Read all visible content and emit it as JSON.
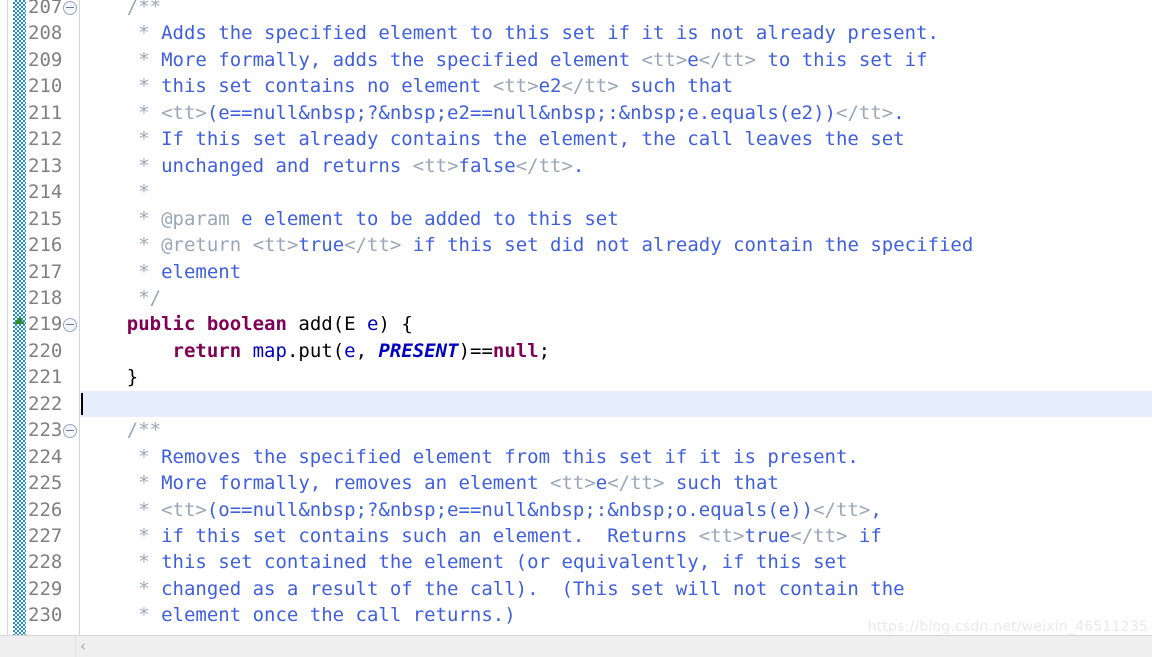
{
  "app": {
    "kind": "java-source-editor",
    "language": "Java",
    "theme_background": "#ffffff"
  },
  "colors": {
    "javadoc_text": "#3f5fdf",
    "javadoc_tag": "#9ba6b8",
    "keyword": "#7f0055",
    "field": "#0000c0",
    "static_field": "#0000c0",
    "plain": "#000000",
    "current_line_highlight": "#e6eefc",
    "change_bar": "#1e8fd5",
    "line_number": "#808080",
    "marker_green": "#2e8b2e"
  },
  "gutter": {
    "first_visible_line": 207,
    "last_visible_line": 230,
    "fold_marker_lines": [
      207,
      219,
      223
    ],
    "override_marker_lines": [
      219
    ],
    "fold_icon_name": "collapse-circle-icon",
    "override_icon_name": "overrides-method-triangle-icon"
  },
  "editor": {
    "cursor_line": 222,
    "current_line": 222,
    "lines": [
      {
        "n": "207",
        "fold": true,
        "marker": false,
        "tokens": [
          {
            "c": "t-doctag",
            "t": "    /**"
          }
        ]
      },
      {
        "n": "208",
        "fold": false,
        "marker": false,
        "tokens": [
          {
            "c": "t-doctag",
            "t": "     * "
          },
          {
            "c": "t-doc",
            "t": "Adds the specified element to this set if it is not already present."
          }
        ]
      },
      {
        "n": "209",
        "fold": false,
        "marker": false,
        "tokens": [
          {
            "c": "t-doctag",
            "t": "     * "
          },
          {
            "c": "t-doc",
            "t": "More formally, adds the specified element "
          },
          {
            "c": "t-doctag",
            "t": "<tt>"
          },
          {
            "c": "t-doc",
            "t": "e"
          },
          {
            "c": "t-doctag",
            "t": "</tt>"
          },
          {
            "c": "t-doc",
            "t": " to this set if"
          }
        ]
      },
      {
        "n": "210",
        "fold": false,
        "marker": false,
        "tokens": [
          {
            "c": "t-doctag",
            "t": "     * "
          },
          {
            "c": "t-doc",
            "t": "this set contains no element "
          },
          {
            "c": "t-doctag",
            "t": "<tt>"
          },
          {
            "c": "t-doc",
            "t": "e2"
          },
          {
            "c": "t-doctag",
            "t": "</tt>"
          },
          {
            "c": "t-doc",
            "t": " such that"
          }
        ]
      },
      {
        "n": "211",
        "fold": false,
        "marker": false,
        "tokens": [
          {
            "c": "t-doctag",
            "t": "     * "
          },
          {
            "c": "t-doctag",
            "t": "<tt>"
          },
          {
            "c": "t-doc",
            "t": "(e==null&nbsp;?&nbsp;e2==null&nbsp;:&nbsp;e.equals(e2))"
          },
          {
            "c": "t-doctag",
            "t": "</tt>"
          },
          {
            "c": "t-doc",
            "t": "."
          }
        ]
      },
      {
        "n": "212",
        "fold": false,
        "marker": false,
        "tokens": [
          {
            "c": "t-doctag",
            "t": "     * "
          },
          {
            "c": "t-doc",
            "t": "If this set already contains the element, the call leaves the set"
          }
        ]
      },
      {
        "n": "213",
        "fold": false,
        "marker": false,
        "tokens": [
          {
            "c": "t-doctag",
            "t": "     * "
          },
          {
            "c": "t-doc",
            "t": "unchanged and returns "
          },
          {
            "c": "t-doctag",
            "t": "<tt>"
          },
          {
            "c": "t-doc",
            "t": "false"
          },
          {
            "c": "t-doctag",
            "t": "</tt>"
          },
          {
            "c": "t-doc",
            "t": "."
          }
        ]
      },
      {
        "n": "214",
        "fold": false,
        "marker": false,
        "tokens": [
          {
            "c": "t-doctag",
            "t": "     *"
          }
        ]
      },
      {
        "n": "215",
        "fold": false,
        "marker": false,
        "tokens": [
          {
            "c": "t-doctag",
            "t": "     * "
          },
          {
            "c": "t-doctag",
            "t": "@param"
          },
          {
            "c": "t-doc",
            "t": " e element to be added to this set"
          }
        ]
      },
      {
        "n": "216",
        "fold": false,
        "marker": false,
        "tokens": [
          {
            "c": "t-doctag",
            "t": "     * "
          },
          {
            "c": "t-doctag",
            "t": "@return"
          },
          {
            "c": "t-doc",
            "t": " "
          },
          {
            "c": "t-doctag",
            "t": "<tt>"
          },
          {
            "c": "t-doc",
            "t": "true"
          },
          {
            "c": "t-doctag",
            "t": "</tt>"
          },
          {
            "c": "t-doc",
            "t": " if this set did not already contain the specified"
          }
        ]
      },
      {
        "n": "217",
        "fold": false,
        "marker": false,
        "tokens": [
          {
            "c": "t-doctag",
            "t": "     * "
          },
          {
            "c": "t-doc",
            "t": "element"
          }
        ]
      },
      {
        "n": "218",
        "fold": false,
        "marker": false,
        "tokens": [
          {
            "c": "t-doctag",
            "t": "     */"
          }
        ]
      },
      {
        "n": "219",
        "fold": true,
        "marker": true,
        "tokens": [
          {
            "c": "t-plain",
            "t": "    "
          },
          {
            "c": "t-kw",
            "t": "public"
          },
          {
            "c": "t-plain",
            "t": " "
          },
          {
            "c": "t-kw",
            "t": "boolean"
          },
          {
            "c": "t-plain",
            "t": " add(E "
          },
          {
            "c": "t-field",
            "t": "e"
          },
          {
            "c": "t-plain",
            "t": ") {"
          }
        ]
      },
      {
        "n": "220",
        "fold": false,
        "marker": false,
        "tokens": [
          {
            "c": "t-plain",
            "t": "        "
          },
          {
            "c": "t-kw",
            "t": "return"
          },
          {
            "c": "t-plain",
            "t": " "
          },
          {
            "c": "t-field",
            "t": "map"
          },
          {
            "c": "t-plain",
            "t": ".put("
          },
          {
            "c": "t-field",
            "t": "e"
          },
          {
            "c": "t-plain",
            "t": ", "
          },
          {
            "c": "t-static",
            "t": "PRESENT"
          },
          {
            "c": "t-plain",
            "t": ")=="
          },
          {
            "c": "t-kw",
            "t": "null"
          },
          {
            "c": "t-plain",
            "t": ";"
          }
        ]
      },
      {
        "n": "221",
        "fold": false,
        "marker": false,
        "tokens": [
          {
            "c": "t-plain",
            "t": "    }"
          }
        ]
      },
      {
        "n": "222",
        "fold": false,
        "marker": false,
        "tokens": [
          {
            "c": "t-plain",
            "t": ""
          }
        ]
      },
      {
        "n": "223",
        "fold": true,
        "marker": false,
        "tokens": [
          {
            "c": "t-doctag",
            "t": "    /**"
          }
        ]
      },
      {
        "n": "224",
        "fold": false,
        "marker": false,
        "tokens": [
          {
            "c": "t-doctag",
            "t": "     * "
          },
          {
            "c": "t-doc",
            "t": "Removes the specified element from this set if it is present."
          }
        ]
      },
      {
        "n": "225",
        "fold": false,
        "marker": false,
        "tokens": [
          {
            "c": "t-doctag",
            "t": "     * "
          },
          {
            "c": "t-doc",
            "t": "More formally, removes an element "
          },
          {
            "c": "t-doctag",
            "t": "<tt>"
          },
          {
            "c": "t-doc",
            "t": "e"
          },
          {
            "c": "t-doctag",
            "t": "</tt>"
          },
          {
            "c": "t-doc",
            "t": " such that"
          }
        ]
      },
      {
        "n": "226",
        "fold": false,
        "marker": false,
        "tokens": [
          {
            "c": "t-doctag",
            "t": "     * "
          },
          {
            "c": "t-doctag",
            "t": "<tt>"
          },
          {
            "c": "t-doc",
            "t": "(o==null&nbsp;?&nbsp;e==null&nbsp;:&nbsp;o.equals(e))"
          },
          {
            "c": "t-doctag",
            "t": "</tt>"
          },
          {
            "c": "t-doc",
            "t": ","
          }
        ]
      },
      {
        "n": "227",
        "fold": false,
        "marker": false,
        "tokens": [
          {
            "c": "t-doctag",
            "t": "     * "
          },
          {
            "c": "t-doc",
            "t": "if this set contains such an element.  Returns "
          },
          {
            "c": "t-doctag",
            "t": "<tt>"
          },
          {
            "c": "t-doc",
            "t": "true"
          },
          {
            "c": "t-doctag",
            "t": "</tt>"
          },
          {
            "c": "t-doc",
            "t": " if"
          }
        ]
      },
      {
        "n": "228",
        "fold": false,
        "marker": false,
        "tokens": [
          {
            "c": "t-doctag",
            "t": "     * "
          },
          {
            "c": "t-doc",
            "t": "this set contained the element (or equivalently, if this set"
          }
        ]
      },
      {
        "n": "229",
        "fold": false,
        "marker": false,
        "tokens": [
          {
            "c": "t-doctag",
            "t": "     * "
          },
          {
            "c": "t-doc",
            "t": "changed as a result of the call).  (This set will not contain the"
          }
        ]
      },
      {
        "n": "230",
        "fold": false,
        "marker": false,
        "tokens": [
          {
            "c": "t-doctag",
            "t": "     * "
          },
          {
            "c": "t-doc",
            "t": "element once the call returns.)"
          }
        ]
      }
    ]
  },
  "scrollbar": {
    "left_arrow_glyph": "‹",
    "orientation": "horizontal"
  },
  "watermark": {
    "text": "https://blog.csdn.net/weixin_46511235"
  }
}
